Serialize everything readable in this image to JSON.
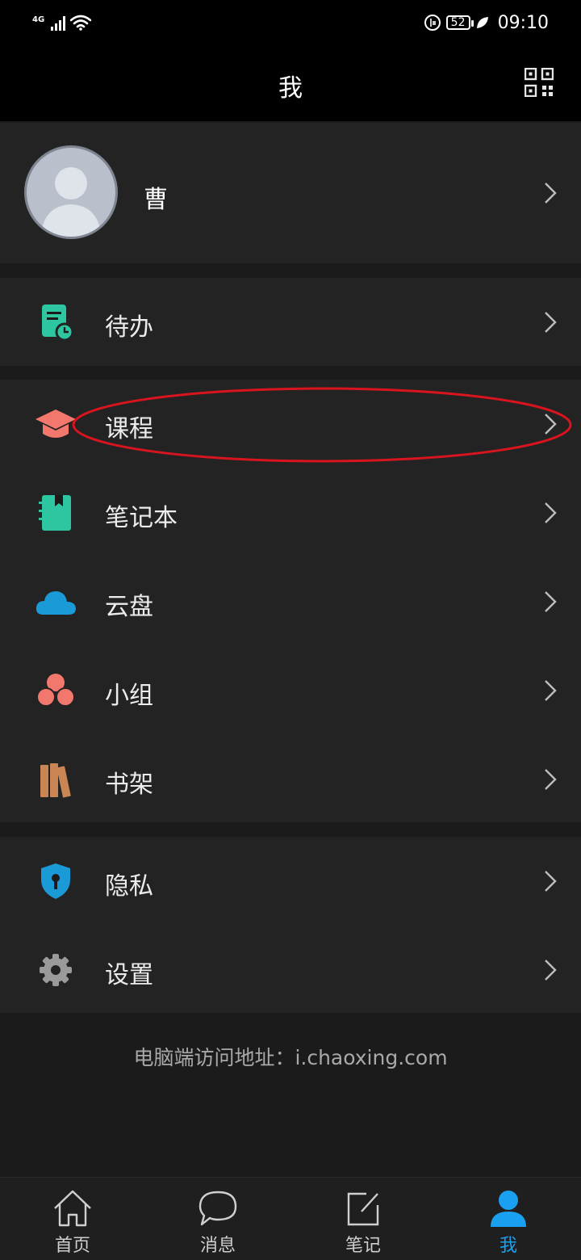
{
  "status_bar": {
    "network": "4G",
    "battery": "52",
    "time": "09:10"
  },
  "header": {
    "title": "我"
  },
  "profile": {
    "name": "曹"
  },
  "menu": {
    "todo": "待办",
    "course": "课程",
    "notebook": "笔记本",
    "cloud": "云盘",
    "group": "小组",
    "bookshelf": "书架",
    "privacy": "隐私",
    "settings": "设置"
  },
  "footer": {
    "text": "电脑端访问地址：i.chaoxing.com"
  },
  "tabs": [
    {
      "label": "首页"
    },
    {
      "label": "消息"
    },
    {
      "label": "笔记"
    },
    {
      "label": "我"
    }
  ],
  "colors": {
    "accent": "#1aa0f0",
    "teal": "#2ec6a0",
    "salmon": "#f2776c",
    "cloud_blue": "#1a9ad6",
    "book_brown": "#c98654",
    "annotation_red": "#d8141e"
  }
}
